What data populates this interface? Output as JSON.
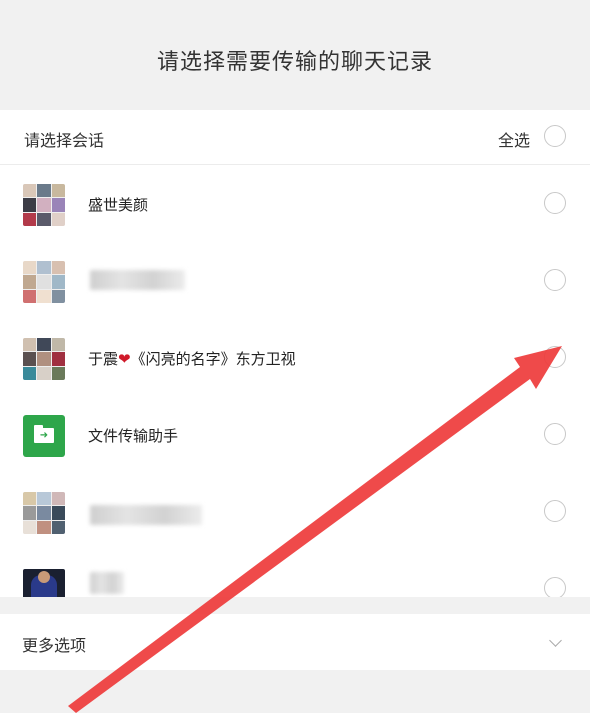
{
  "header": {
    "title": "请选择需要传输的聊天记录"
  },
  "select_bar": {
    "label": "请选择会话",
    "select_all": "全选"
  },
  "chats": [
    {
      "name": "盛世美颜",
      "avatar": "group-avatar",
      "blurred": false
    },
    {
      "name": "",
      "avatar": "group-avatar",
      "blurred": true
    },
    {
      "name_prefix": "于震",
      "emoji": "❤️",
      "name_suffix": "《闪亮的名字》东方卫视",
      "avatar": "group-avatar",
      "blurred": false
    },
    {
      "name": "文件传输助手",
      "avatar": "file-transfer-icon",
      "blurred": false
    },
    {
      "name": "",
      "avatar": "group-avatar",
      "blurred": true
    },
    {
      "name": "",
      "avatar": "user-avatar",
      "blurred": true
    }
  ],
  "more_options": {
    "label": "更多选项",
    "icon": "chevron-down-icon"
  },
  "colors": {
    "accent_green": "#2ea64a",
    "annotation_arrow": "#ee3b3b",
    "background": "#f1f1f1"
  }
}
